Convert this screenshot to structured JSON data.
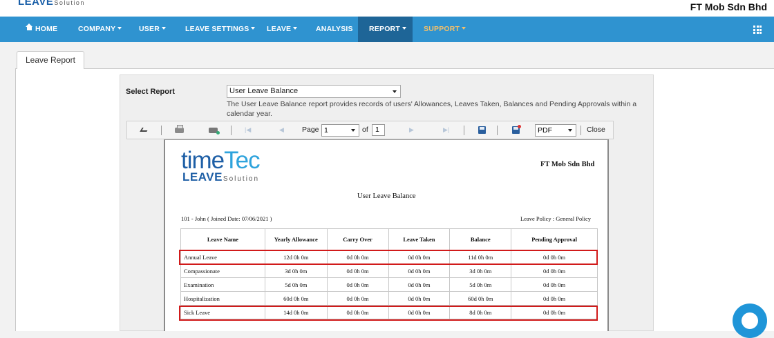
{
  "brand": {
    "logo_main": "LEAVE",
    "logo_sub": "Solution"
  },
  "header": {
    "company": "FT Mob Sdn Bhd"
  },
  "nav": {
    "home": "HOME",
    "company": "COMPANY",
    "user": "USER",
    "leave_settings": "LEAVE SETTINGS",
    "leave": "LEAVE",
    "analysis": "ANALYSIS",
    "report": "REPORT",
    "support": "SUPPORT"
  },
  "tab": {
    "label": "Leave Report"
  },
  "form": {
    "select_label": "Select Report",
    "selected_report": "User Leave Balance",
    "description": "The User Leave Balance report provides records of users' Allowances, Leaves Taken, Balances and Pending Approvals within a calendar year."
  },
  "toolbar": {
    "page_label": "Page",
    "page_value": "1",
    "of_label": "of",
    "total_pages": "1",
    "format": "PDF",
    "close_label": "Close"
  },
  "report": {
    "logo_time": "time",
    "logo_tec": "Tec",
    "logo_leave": "LEAVE",
    "logo_solution": "Solution",
    "company": "FT Mob Sdn Bhd",
    "title": "User Leave Balance",
    "user_info": "101 - John ( Joined Date: 07/06/2021 )",
    "policy": "Leave Policy : General Policy",
    "columns": [
      "Leave Name",
      "Yearly Allowance",
      "Carry Over",
      "Leave Taken",
      "Balance",
      "Pending Approval"
    ],
    "rows": [
      [
        "Annual Leave",
        "12d 0h 0m",
        "0d 0h 0m",
        "0d 0h 0m",
        "11d 0h 0m",
        "0d 0h 0m"
      ],
      [
        "Compassionate",
        "3d 0h 0m",
        "0d 0h 0m",
        "0d 0h 0m",
        "3d 0h 0m",
        "0d 0h 0m"
      ],
      [
        "Examination",
        "5d 0h 0m",
        "0d 0h 0m",
        "0d 0h 0m",
        "5d 0h 0m",
        "0d 0h 0m"
      ],
      [
        "Hospitalization",
        "60d 0h 0m",
        "0d 0h 0m",
        "0d 0h 0m",
        "60d 0h 0m",
        "0d 0h 0m"
      ],
      [
        "Sick Leave",
        "14d 0h 0m",
        "0d 0h 0m",
        "0d 0h 0m",
        "8d 0h 0m",
        "0d 0h 0m"
      ]
    ]
  }
}
